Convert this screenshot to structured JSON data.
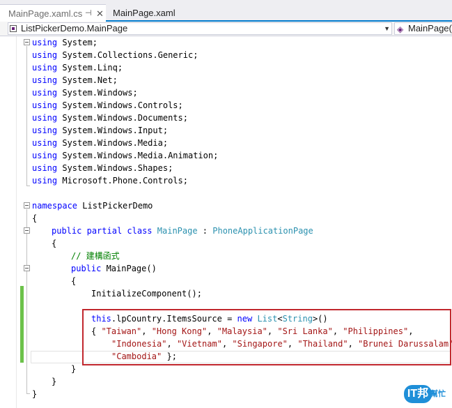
{
  "tabs": {
    "active": {
      "label": "MainPage.xaml.cs",
      "pin": "⊣",
      "close": "✕"
    },
    "second": {
      "label": "MainPage.xaml"
    }
  },
  "nav": {
    "class_dropdown": "ListPickerDemo.MainPage",
    "member_dropdown": "MainPage("
  },
  "code": {
    "usings": [
      "System;",
      "System.Collections.Generic;",
      "System.Linq;",
      "System.Net;",
      "System.Windows;",
      "System.Windows.Controls;",
      "System.Windows.Documents;",
      "System.Windows.Input;",
      "System.Windows.Media;",
      "System.Windows.Media.Animation;",
      "System.Windows.Shapes;",
      "Microsoft.Phone.Controls;"
    ],
    "kw_using": "using",
    "kw_namespace": "namespace",
    "namespace_name": " ListPickerDemo",
    "brace_open": "{",
    "brace_close": "}",
    "kw_public": "public",
    "kw_partial": "partial",
    "kw_class": "class",
    "class_name": "MainPage",
    "colon": " : ",
    "base_class": "PhoneApplicationPage",
    "comment": "// 建構函式",
    "ctor": " MainPage()",
    "init_call": "InitializeComponent();",
    "kw_this": "this",
    "assign_mid": ".lpCountry.ItemsSource = ",
    "kw_new": "new",
    "list_type": "List",
    "lt": "<",
    "string_type": "String",
    "gt_paren": ">()",
    "init_open": "{ ",
    "countries_line1": [
      "\"Taiwan\"",
      "\"Hong Kong\"",
      "\"Malaysia\"",
      "\"Sri Lanka\"",
      "\"Philippines\""
    ],
    "countries_line2": [
      "\"Indonesia\"",
      "\"Vietnam\"",
      "\"Singapore\"",
      "\"Thailand\"",
      "\"Brunei Darussalam\""
    ],
    "countries_line3": "\"Cambodia\"",
    "sep": ", ",
    "tail": " };",
    "trail_comma": ","
  },
  "watermark": {
    "logo": "IT邦",
    "sub": "幫忙"
  }
}
